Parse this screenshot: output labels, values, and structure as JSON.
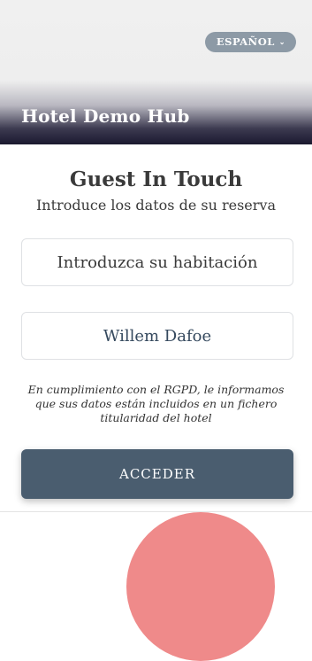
{
  "header": {
    "language_label": "ESPAÑOL",
    "hotel_name": "Hotel Demo Hub"
  },
  "form": {
    "title": "Guest In Touch",
    "subtitle": "Introduce los datos de su reserva",
    "room_placeholder": "Introduzca su habitación",
    "name_value": "Willem Dafoe",
    "notice": "En cumplimiento con el RGPD, le informamos que sus datos están incluidos en un fichero titularidad del hotel",
    "submit_label": "ACCEDER"
  },
  "colors": {
    "button": "#4a5d6f",
    "language_pill": "#8d9aa6",
    "accent_circle": "#ef8a8a"
  }
}
